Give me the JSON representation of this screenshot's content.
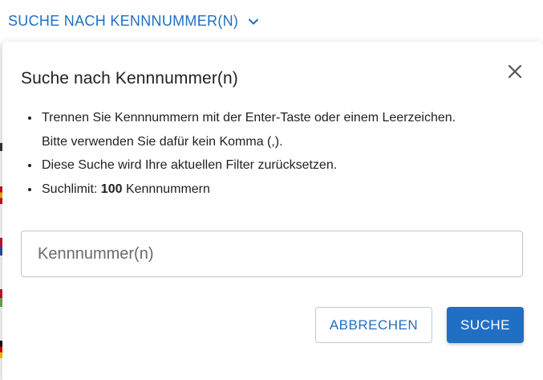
{
  "background": {
    "toggle_label": "SUCHE NACH KENNNUMMER(N)",
    "toggle_icon": "chevron-down-icon"
  },
  "dialog": {
    "title": "Suche nach Kennnummer(n)",
    "close_icon": "close-icon",
    "info": {
      "item1": "Trennen Sie Kennnummern mit der Enter-Taste oder einem Leerzeichen. Bitte verwenden Sie dafür kein Komma (,).",
      "item2": "Diese Suche wird Ihre aktuellen Filter zurücksetzen.",
      "item3_prefix": "Suchlimit: ",
      "item3_limit": "100",
      "item3_suffix": " Kennnummern"
    },
    "input": {
      "placeholder": "Kennnummer(n)",
      "value": ""
    },
    "buttons": {
      "cancel": "ABBRECHEN",
      "search": "SUCHE"
    }
  },
  "colors": {
    "primary": "#1f6fc5",
    "text": "#222222"
  }
}
